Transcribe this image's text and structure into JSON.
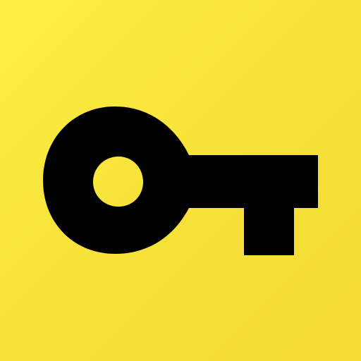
{
  "app_icon": {
    "icon": "key-icon",
    "colors": {
      "background": "#f8e33a",
      "key": "#000000",
      "key_hole": "#f8e33a"
    }
  }
}
